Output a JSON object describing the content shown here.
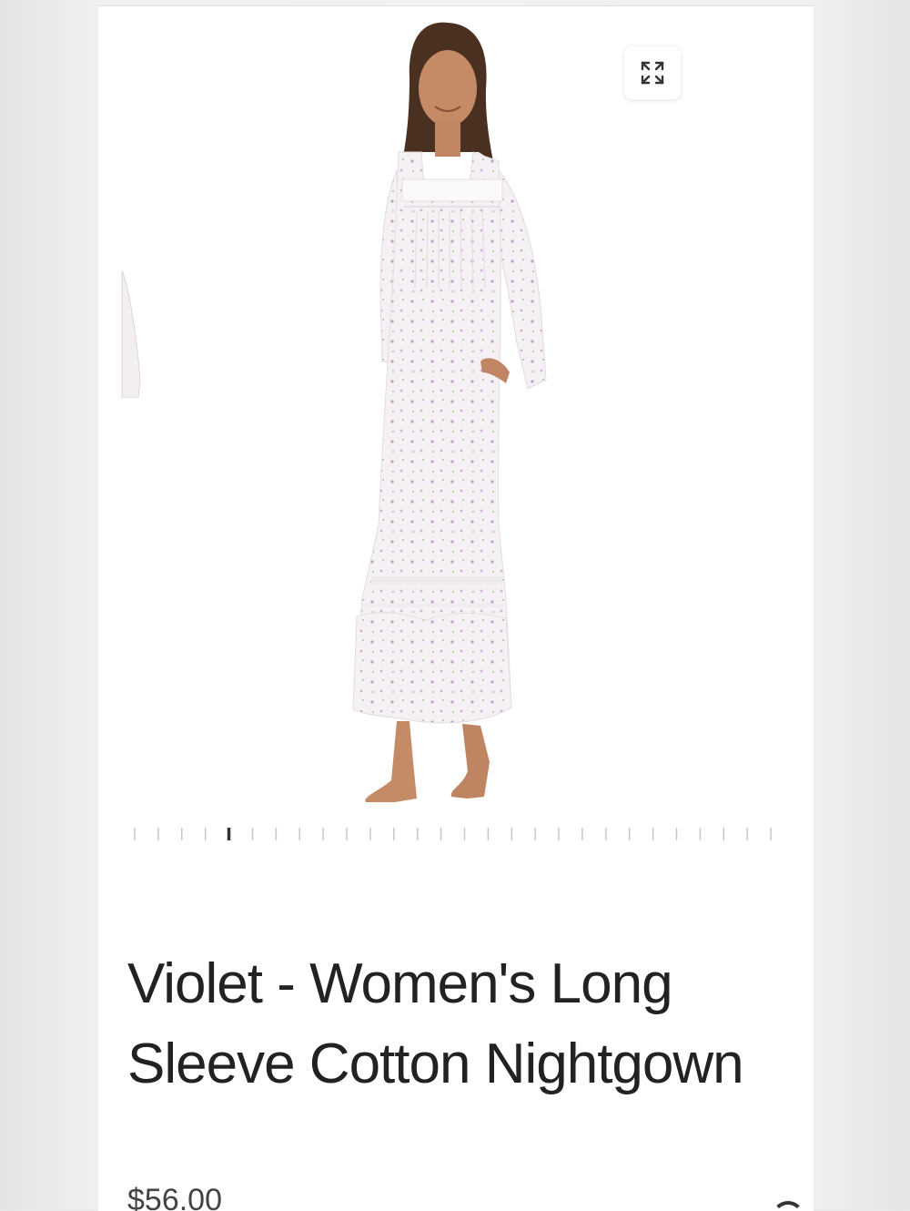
{
  "product": {
    "title": "Violet - Women's Long Sleeve Cotton Nightgown",
    "price": "$56.00"
  },
  "gallery": {
    "expand_icon": "expand-arrows-icon",
    "total_slides": 28,
    "active_slide_index": 4
  },
  "colors": {
    "title_text": "#222222",
    "pager_active": "#333333",
    "pager_inactive": "#c8c8c8",
    "gown_fabric": "#f4eef2",
    "floral_print": "#b9a4c6"
  }
}
